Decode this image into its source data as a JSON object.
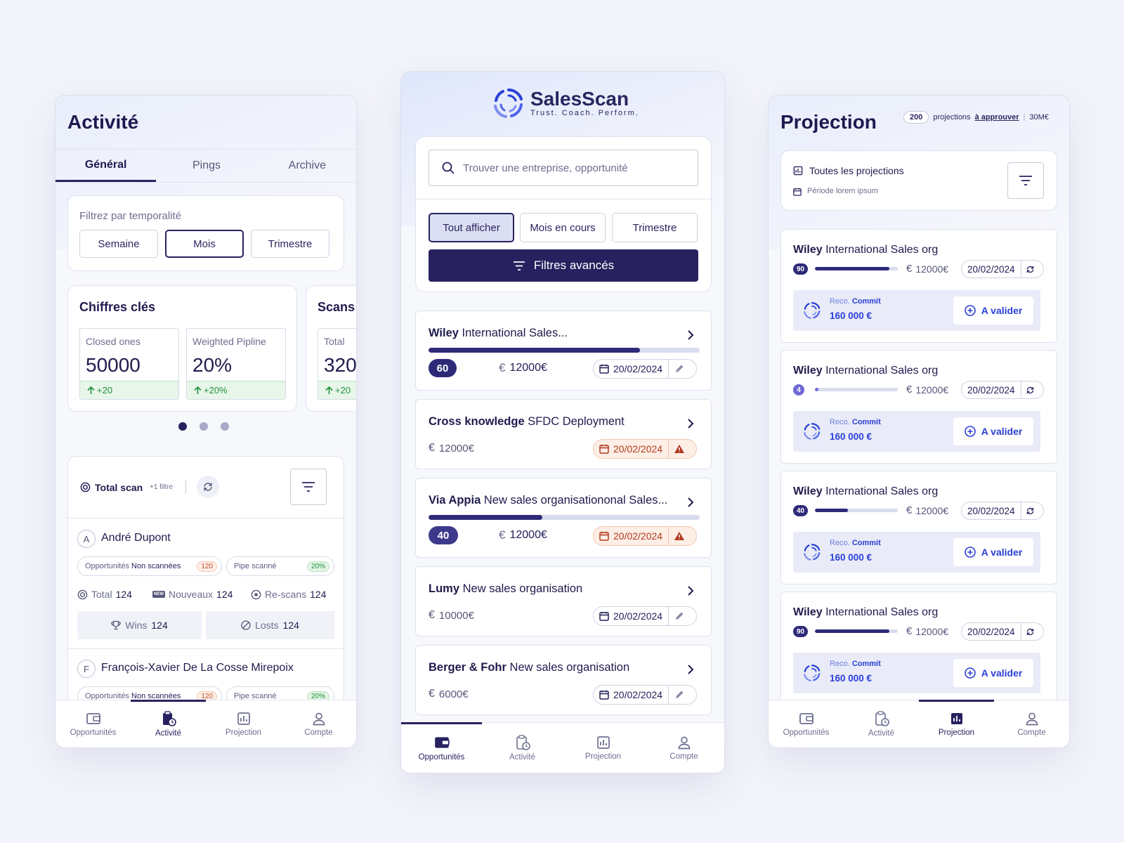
{
  "activite": {
    "title": "Activité",
    "tabs": [
      "Général",
      "Pings",
      "Archive"
    ],
    "filter_label": "Filtrez par temporalité",
    "filter_buttons": [
      "Semaine",
      "Mois",
      "Trimestre"
    ],
    "key_title": "Chiffres clés",
    "scans_title": "Scans",
    "metrics": [
      {
        "label": "Closed ones",
        "value": "50000",
        "delta": "+20"
      },
      {
        "label": "Weighted Pipline",
        "value": "20%",
        "delta": "+20%"
      },
      {
        "label": "Total",
        "value": "320",
        "delta": "+20"
      }
    ],
    "total_scan_label": "Total scan",
    "total_scan_filter": "+1 filtre",
    "persons": [
      {
        "initial": "A",
        "name": "André Dupont",
        "chip1_label": "Opportunités",
        "chip1_bold": "Non scannées",
        "chip1_badge": "120",
        "chip2_label": "Pipe scanné",
        "chip2_badge": "20%",
        "total_label": "Total",
        "total_value": "124",
        "new_label": "Nouveaux",
        "new_value": "124",
        "rescans_label": "Re-scans",
        "rescans_value": "124",
        "wins_label": "Wins",
        "wins_value": "124",
        "losts_label": "Losts",
        "losts_value": "124"
      },
      {
        "initial": "F",
        "name": "François-Xavier De La Cosse Mirepoix",
        "chip1_label": "Opportunités",
        "chip1_bold": "Non scannées",
        "chip1_badge": "120",
        "chip2_label": "Pipe scanné",
        "chip2_badge": "20%"
      }
    ]
  },
  "salesscan": {
    "brand": "SalesScan",
    "tagline": "Trust. Coach. Perform.",
    "search_placeholder": "Trouver une entreprise, opportunité",
    "filter_buttons": [
      "Tout afficher",
      "Mois en cours",
      "Trimestre"
    ],
    "advanced_filters": "Filtres avancés",
    "opportunities": [
      {
        "company": "Wiley",
        "title": "International Sales...",
        "score": "60",
        "progress": 0.78,
        "amount": "12000€",
        "date": "20/02/2024",
        "warning": false
      },
      {
        "company": "Cross knowledge",
        "title": "SFDC Deployment",
        "score": "",
        "progress": null,
        "amount": "12000€",
        "date": "20/02/2024",
        "warning": true
      },
      {
        "company": "Via Appia",
        "title": "New sales organisationonal Sales...",
        "score": "40",
        "progress": 0.42,
        "amount": "12000€",
        "date": "20/02/2024",
        "warning": true
      },
      {
        "company": "Lumy",
        "title": "New sales organisation",
        "score": "",
        "progress": null,
        "amount": "10000€",
        "date": "20/02/2024",
        "warning": false
      },
      {
        "company": "Berger & Fohr",
        "title": "New sales organisation",
        "score": "",
        "progress": null,
        "amount": "6000€",
        "date": "20/02/2024",
        "warning": false
      }
    ]
  },
  "projection": {
    "title": "Projection",
    "badge": "200",
    "info_text": "projections",
    "info_link": "à approuver",
    "info_amount": "30M€",
    "all_label": "Toutes les projections",
    "period_label": "Période lorem ipsum",
    "items": [
      {
        "company": "Wiley",
        "title": "International Sales org",
        "score": "90",
        "progress": 0.9,
        "amount": "12000€",
        "date": "20/02/2024",
        "reco": "Reco.",
        "commit": "Commit",
        "value": "160 000 €",
        "action": "A valider"
      },
      {
        "company": "Wiley",
        "title": "International Sales org",
        "score": "4",
        "progress": 0.04,
        "amount": "12000€",
        "date": "20/02/2024",
        "reco": "Reco.",
        "commit": "Commit",
        "value": "160 000 €",
        "action": "A valider"
      },
      {
        "company": "Wiley",
        "title": "International Sales org",
        "score": "40",
        "progress": 0.4,
        "amount": "12000€",
        "date": "20/02/2024",
        "reco": "Reco.",
        "commit": "Commit",
        "value": "160 000 €",
        "action": "A valider"
      },
      {
        "company": "Wiley",
        "title": "International Sales org",
        "score": "90",
        "progress": 0.9,
        "amount": "12000€",
        "date": "20/02/2024",
        "reco": "Reco.",
        "commit": "Commit",
        "value": "160 000 €",
        "action": "A valider"
      }
    ]
  },
  "nav": [
    "Opportunités",
    "Activité",
    "Projection",
    "Compte"
  ],
  "colors": {
    "primary": "#2e2a78",
    "accent_blue": "#2a3fd6",
    "success": "#1f8f3a",
    "warning": "#b1391c"
  }
}
